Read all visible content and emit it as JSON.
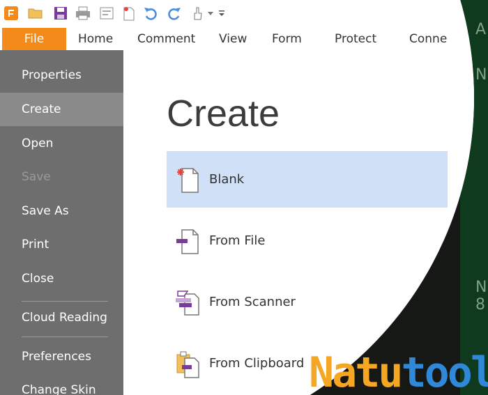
{
  "ribbon": {
    "tabs": [
      "File",
      "Home",
      "Comment",
      "View",
      "Form",
      "Protect",
      "Conne"
    ]
  },
  "sidebar": {
    "items": [
      {
        "label": "Properties"
      },
      {
        "label": "Create"
      },
      {
        "label": "Open"
      },
      {
        "label": "Save"
      },
      {
        "label": "Save As"
      },
      {
        "label": "Print"
      },
      {
        "label": "Close"
      },
      {
        "label": "Cloud Reading"
      },
      {
        "label": "Preferences"
      },
      {
        "label": "Change Skin"
      }
    ]
  },
  "main": {
    "title": "Create",
    "options": [
      {
        "label": "Blank",
        "icon": "blank-document-icon"
      },
      {
        "label": "From File",
        "icon": "from-file-icon"
      },
      {
        "label": "From Scanner",
        "icon": "scanner-icon"
      },
      {
        "label": "From Clipboard",
        "icon": "clipboard-icon"
      }
    ]
  },
  "watermark": {
    "part1": "Natu",
    "part2": "tool"
  },
  "colors": {
    "file_tab": "#f48a1a",
    "sidebar": "#6e6e6e",
    "selected": "#cfe0f7",
    "accent_purple": "#7a3c9a"
  }
}
